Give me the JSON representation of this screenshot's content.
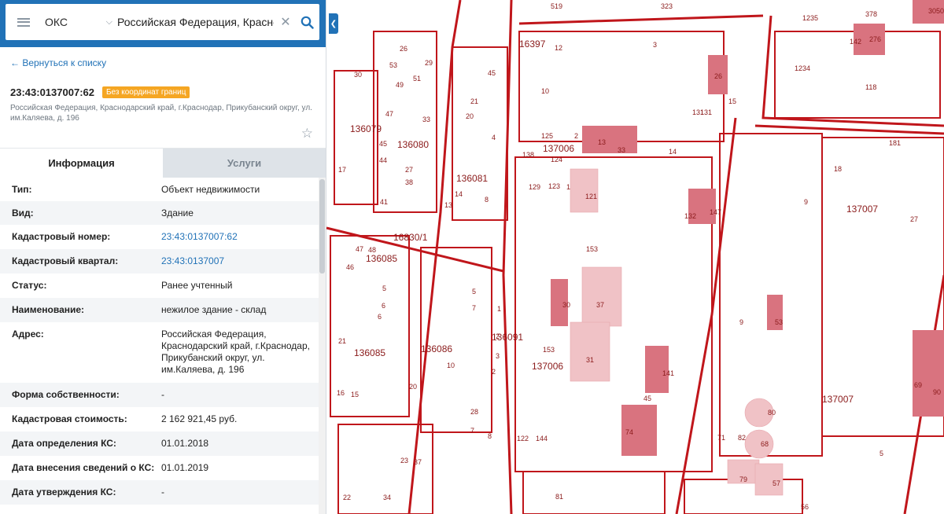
{
  "search": {
    "type_value": "ОКС",
    "query": "Российская Федерация, Краснодарский край"
  },
  "nav": {
    "back_label": "← Вернуться к списку"
  },
  "object": {
    "cadastral_title": "23:43:0137007:62",
    "badge": "Без координат границ",
    "address": "Российская Федерация, Краснодарский край, г.Краснодар, Прикубанский округ, ул. им.Каляева, д. 196"
  },
  "tabs": {
    "info": "Информация",
    "services": "Услуги"
  },
  "info_rows": [
    {
      "label": "Тип:",
      "value": "Объект недвижимости"
    },
    {
      "label": "Вид:",
      "value": "Здание"
    },
    {
      "label": "Кадастровый номер:",
      "value": "23:43:0137007:62"
    },
    {
      "label": "Кадастровый квартал:",
      "value": "23:43:0137007"
    },
    {
      "label": "Статус:",
      "value": "Ранее учтенный"
    },
    {
      "label": "Наименование:",
      "value": "нежилое здание - склад"
    },
    {
      "label": "Адрес:",
      "value": "Российская Федерация, Краснодарский край, г.Краснодар, Прикубанский округ, ул. им.Каляева, д. 196"
    },
    {
      "label": "Форма собственности:",
      "value": "-"
    },
    {
      "label": "Кадастровая стоимость:",
      "value": "2 162 921,45 руб."
    },
    {
      "label": "Дата определения КС:",
      "value": "01.01.2018"
    },
    {
      "label": "Дата внесения сведений о КС:",
      "value": "01.01.2019"
    },
    {
      "label": "Дата утверждения КС:",
      "value": "-"
    }
  ],
  "map": {
    "labels": [
      "519",
      "323",
      "378",
      "3050",
      "1235",
      "16397",
      "12",
      "3",
      "131",
      "142",
      "276",
      "1234",
      "118",
      "30",
      "53",
      "26",
      "51",
      "29",
      "49",
      "45",
      "10",
      "26",
      "15",
      "131",
      "21",
      "20",
      "47",
      "33",
      "136080",
      "136079",
      "125",
      "2",
      "137006",
      "13",
      "33",
      "14",
      "181",
      "138",
      "124",
      "4",
      "18",
      "45",
      "27",
      "17",
      "44",
      "38",
      "136081",
      "129",
      "123",
      "121",
      "1",
      "132",
      "147",
      "9",
      "137007",
      "27",
      "14",
      "8",
      "41",
      "13",
      "16830/1",
      "153",
      "46",
      "47",
      "48",
      "136085",
      "5",
      "1",
      "37",
      "30",
      "6",
      "5",
      "7",
      "6",
      "2",
      "9",
      "53",
      "21",
      "136085",
      "136086",
      "10",
      "3",
      "153",
      "31",
      "137006",
      "141",
      "45",
      "137007",
      "69",
      "90",
      "20",
      "16",
      "15",
      "28",
      "7",
      "8",
      "122",
      "144",
      "74",
      "71",
      "82",
      "80",
      "68",
      "5",
      "2",
      "136091",
      "22",
      "23",
      "37",
      "34",
      "81",
      "79",
      "57",
      "56"
    ]
  },
  "colors": {
    "accent": "#2172b7",
    "badge": "#f5a623",
    "parcel": "#c0161b",
    "building": "#d9737f"
  }
}
